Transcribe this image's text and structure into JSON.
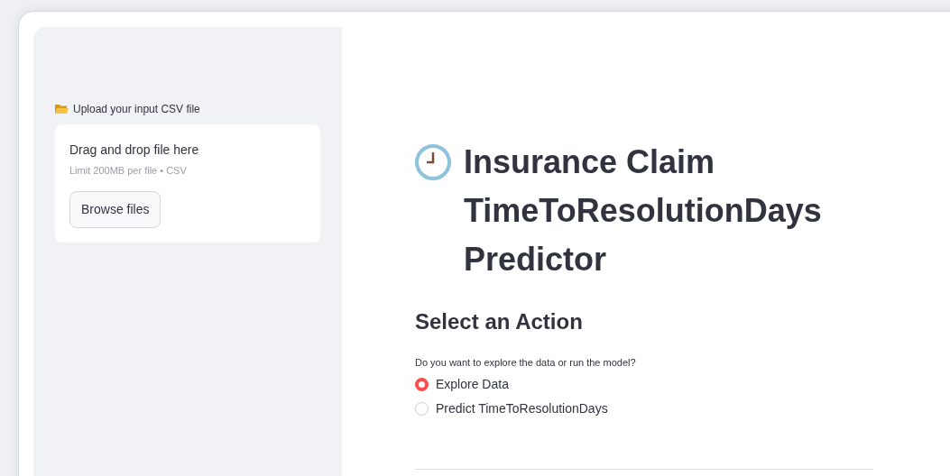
{
  "sidebar": {
    "upload_label": "Upload your input CSV file",
    "dropzone": {
      "title": "Drag and drop file here",
      "hint": "Limit 200MB per file • CSV",
      "button": "Browse files"
    }
  },
  "main": {
    "title": "Insurance Claim TimeToResolutionDays Predictor",
    "subheader": "Select an Action",
    "radio_label": "Do you want to explore the data or run the model?",
    "options": [
      {
        "label": "Explore Data",
        "selected": true
      },
      {
        "label": "Predict TimeToResolutionDays",
        "selected": false
      }
    ]
  }
}
